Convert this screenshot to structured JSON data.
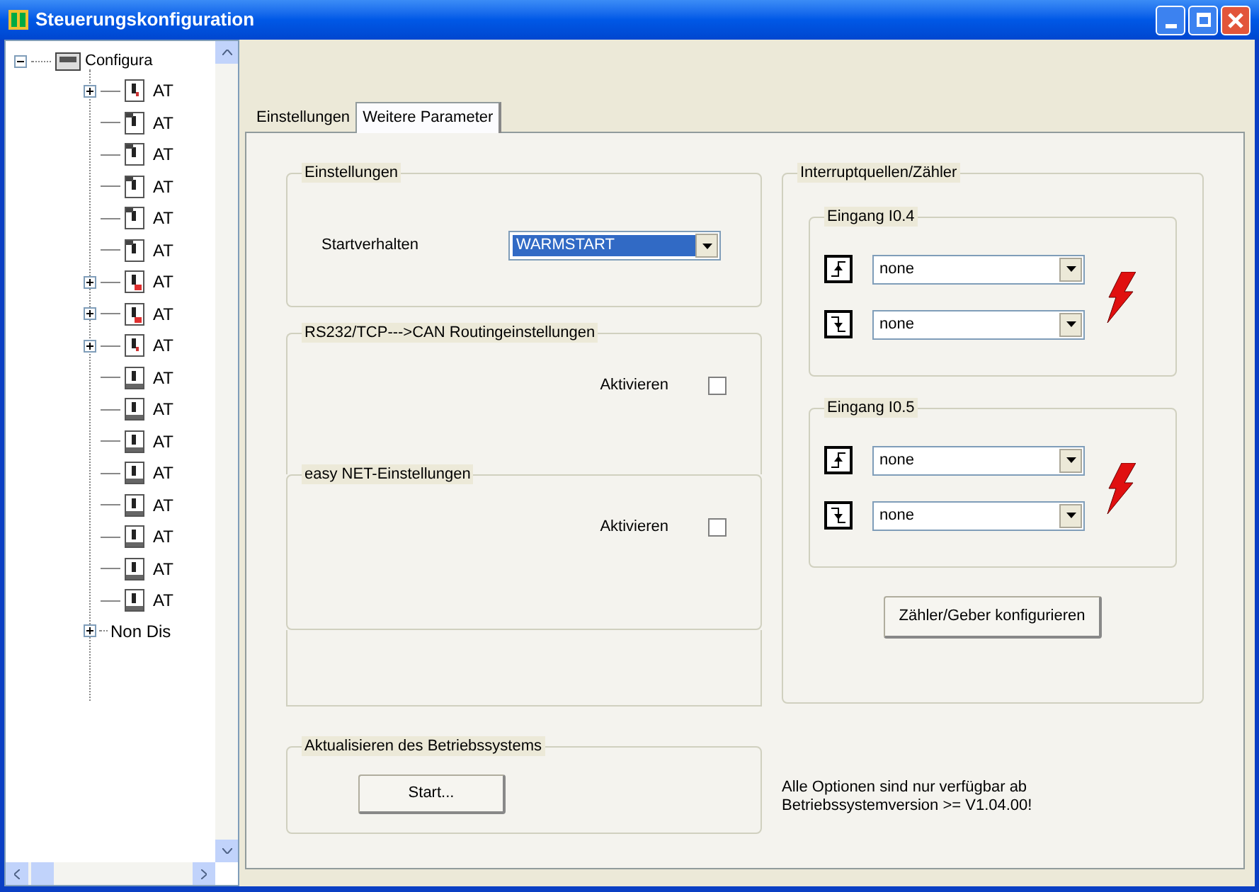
{
  "window": {
    "title": "Steuerungskonfiguration"
  },
  "tree": {
    "label": "Configura",
    "expanded": true,
    "children": [
      {
        "label": "AT",
        "kind": "module",
        "expanded": false
      },
      {
        "label": "AT",
        "kind": "panel"
      },
      {
        "label": "AT",
        "kind": "panel"
      },
      {
        "label": "AT",
        "kind": "panel"
      },
      {
        "label": "AT",
        "kind": "panel"
      },
      {
        "label": "AT",
        "kind": "panel"
      },
      {
        "label": "AT",
        "kind": "alarm",
        "expanded": false
      },
      {
        "label": "AT",
        "kind": "alarm",
        "expanded": false
      },
      {
        "label": "AT",
        "kind": "module",
        "expanded": false
      },
      {
        "label": "AT",
        "kind": "base"
      },
      {
        "label": "AT",
        "kind": "base"
      },
      {
        "label": "AT",
        "kind": "base"
      },
      {
        "label": "AT",
        "kind": "base"
      },
      {
        "label": "AT",
        "kind": "base"
      },
      {
        "label": "AT",
        "kind": "base"
      },
      {
        "label": "AT",
        "kind": "base"
      },
      {
        "label": "AT",
        "kind": "base"
      }
    ],
    "after": {
      "label": "Non Dis",
      "expanded": false
    }
  },
  "tabs": [
    {
      "label": "Einstellungen",
      "selected": false
    },
    {
      "label": "Weitere Parameter",
      "selected": true
    }
  ],
  "einstellungen": {
    "title": "Einstellungen",
    "label": "Startverhalten",
    "value": "WARMSTART"
  },
  "routing": {
    "title": "RS232/TCP--->CAN Routingeinstellungen",
    "label": "Aktivieren",
    "checked": false
  },
  "easynet": {
    "title": "easy NET-Einstellungen",
    "label": "Aktivieren",
    "checked": false
  },
  "interrupts": {
    "title": "Interruptquellen/Zähler",
    "inputs": [
      {
        "title": "Eingang I0.4",
        "rising": "none",
        "falling": "none"
      },
      {
        "title": "Eingang I0.5",
        "rising": "none",
        "falling": "none"
      }
    ],
    "button": "Zähler/Geber konfigurieren"
  },
  "update": {
    "title": "Aktualisieren des Betriebssystems",
    "button": "Start..."
  },
  "note": "Alle Optionen sind nur verfügbar ab Betriebssystemversion >= V1.04.00!"
}
